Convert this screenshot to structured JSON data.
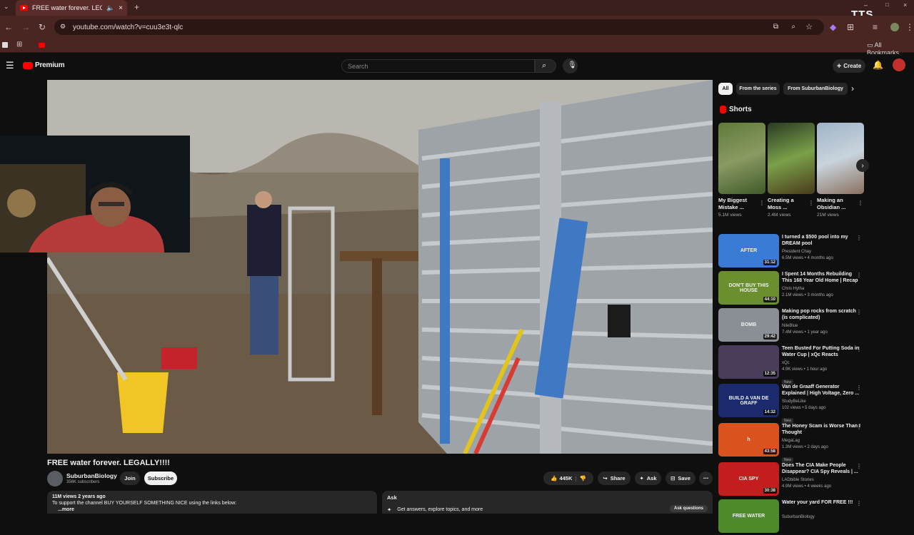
{
  "browser": {
    "tab_title": "FREE water forever. LEGALLY",
    "url": "youtube.com/watch?v=cuu3e3t-qlc",
    "bookmarks_label": "All Bookmarks",
    "tts_label": "TTS"
  },
  "header": {
    "logo_text": "Premium",
    "search_placeholder": "Search",
    "create_label": "Create"
  },
  "video": {
    "title": "FREE water forever. LEGALLY!!!!",
    "channel_name": "SuburbanBiology",
    "subscribers": "356K subscribers",
    "join_label": "Join",
    "subscribe_label": "Subscribe",
    "likes": "445K",
    "share_label": "Share",
    "ask_label": "Ask",
    "save_label": "Save",
    "views_time": "11M views  2 years ago",
    "description_line": "To support the channel BUY YOURSELF SOMETHING NICE using the links below:",
    "more_label": "...more",
    "ask_box_title": "Ask",
    "ask_box_prompt": "Get answers, explore topics, and more",
    "ask_questions_label": "Ask questions"
  },
  "chips": [
    "All",
    "From the series",
    "From SuburbanBiology"
  ],
  "shorts": {
    "heading": "Shorts",
    "items": [
      {
        "title": "My Biggest Mistake ...",
        "views": "5.1M views"
      },
      {
        "title": "Creating a Moss ...",
        "views": "2.4M views"
      },
      {
        "title": "Making an Obsidian ...",
        "views": "21M views"
      }
    ]
  },
  "recommendations": [
    {
      "title": "I turned a $500 pool into my DREAM pool",
      "channel": "President Chay",
      "meta": "6.5M views • 4 months ago",
      "duration": "31:12",
      "thumb_text": "AFTER",
      "thumb_color": "#3a7bd5"
    },
    {
      "title": "I Spent 14 Months Rebuilding This 168 Year Old Home | Recap",
      "channel": "Chris Hytha",
      "meta": "2.1M views • 3 months ago",
      "duration": "44:10",
      "thumb_text": "DON'T BUY THIS HOUSE",
      "thumb_color": "#6b8f2e"
    },
    {
      "title": "Making pop rocks from scratch (is complicated)",
      "channel": "NileBlue",
      "meta": "7.4M views • 1 year ago",
      "duration": "29:42",
      "thumb_text": "BOMB",
      "thumb_color": "#8a8f96"
    },
    {
      "title": "Teen Busted For Putting Soda in Water Cup | xQc Reacts",
      "channel": "xQc",
      "meta": "4.9K views • 1 hour ago",
      "badge": "New",
      "duration": "12:35",
      "thumb_text": "",
      "thumb_color": "#4a3d5c"
    },
    {
      "title": "Van de Graaff Generator Explained | High Voltage, Zero ...",
      "channel": "StudyBeLike",
      "meta": "102 views • 5 days ago",
      "badge": "New",
      "duration": "14:32",
      "thumb_text": "BUILD A VAN DE GRAFF",
      "thumb_color": "#1a2a6c"
    },
    {
      "title": "The Honey Scam is Worse Than I Thought",
      "channel": "MegaLag",
      "meta": "1.3M views • 2 days ago",
      "badge": "New",
      "duration": "43:58",
      "thumb_text": "h",
      "thumb_color": "#d9531e"
    },
    {
      "title": "Does The CIA Make People Disappear? CIA Spy Reveals | ...",
      "channel": "LADbible Stories",
      "meta": "4.9M views • 4 weeks ago",
      "duration": "30:38",
      "thumb_text": "CIA SPY",
      "thumb_color": "#c41d1d"
    },
    {
      "title": "Water your yard FOR FREE !!!",
      "channel": "SuburbanBiology",
      "meta": "",
      "duration": "",
      "thumb_text": "FREE WATER",
      "thumb_color": "#4f8a2a"
    }
  ]
}
